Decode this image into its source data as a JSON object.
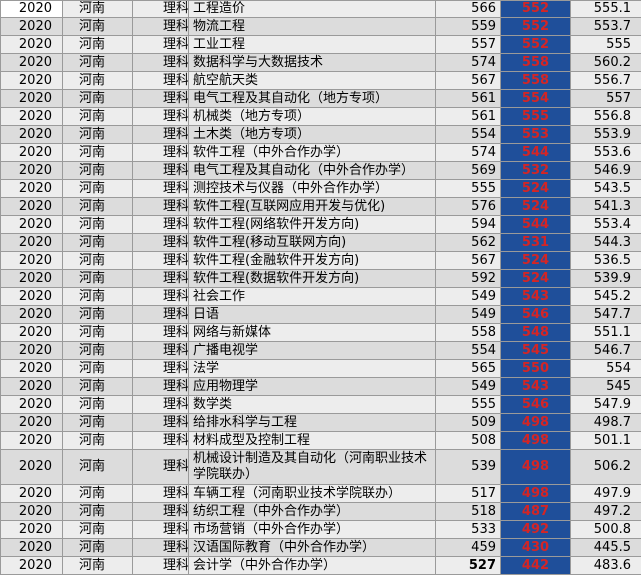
{
  "table": {
    "rows": [
      {
        "year": "2020",
        "province": "河南",
        "category": "理科",
        "major": "工程造价",
        "min": "566",
        "control": "552",
        "avg": "555.1"
      },
      {
        "year": "2020",
        "province": "河南",
        "category": "理科",
        "major": "物流工程",
        "min": "559",
        "control": "552",
        "avg": "553.7"
      },
      {
        "year": "2020",
        "province": "河南",
        "category": "理科",
        "major": "工业工程",
        "min": "557",
        "control": "552",
        "avg": "555"
      },
      {
        "year": "2020",
        "province": "河南",
        "category": "理科",
        "major": "数据科学与大数据技术",
        "min": "574",
        "control": "558",
        "avg": "560.2"
      },
      {
        "year": "2020",
        "province": "河南",
        "category": "理科",
        "major": "航空航天类",
        "min": "567",
        "control": "558",
        "avg": "556.7"
      },
      {
        "year": "2020",
        "province": "河南",
        "category": "理科",
        "major": "电气工程及其自动化（地方专项）",
        "min": "561",
        "control": "554",
        "avg": "557"
      },
      {
        "year": "2020",
        "province": "河南",
        "category": "理科",
        "major": "机械类（地方专项）",
        "min": "561",
        "control": "555",
        "avg": "556.8"
      },
      {
        "year": "2020",
        "province": "河南",
        "category": "理科",
        "major": "土木类（地方专项）",
        "min": "554",
        "control": "553",
        "avg": "553.9"
      },
      {
        "year": "2020",
        "province": "河南",
        "category": "理科",
        "major": "软件工程（中外合作办学）",
        "min": "574",
        "control": "544",
        "avg": "553.6"
      },
      {
        "year": "2020",
        "province": "河南",
        "category": "理科",
        "major": "电气工程及其自动化（中外合作办学）",
        "min": "569",
        "control": "532",
        "avg": "546.9"
      },
      {
        "year": "2020",
        "province": "河南",
        "category": "理科",
        "major": "测控技术与仪器（中外合作办学）",
        "min": "555",
        "control": "524",
        "avg": "543.5"
      },
      {
        "year": "2020",
        "province": "河南",
        "category": "理科",
        "major": "软件工程(互联网应用开发与优化)",
        "min": "576",
        "control": "524",
        "avg": "541.3"
      },
      {
        "year": "2020",
        "province": "河南",
        "category": "理科",
        "major": "软件工程(网络软件开发方向)",
        "min": "594",
        "control": "544",
        "avg": "553.4"
      },
      {
        "year": "2020",
        "province": "河南",
        "category": "理科",
        "major": "软件工程(移动互联网方向)",
        "min": "562",
        "control": "531",
        "avg": "544.3"
      },
      {
        "year": "2020",
        "province": "河南",
        "category": "理科",
        "major": "软件工程(金融软件开发方向)",
        "min": "567",
        "control": "524",
        "avg": "536.5"
      },
      {
        "year": "2020",
        "province": "河南",
        "category": "理科",
        "major": "软件工程(数据软件开发方向)",
        "min": "592",
        "control": "524",
        "avg": "539.9"
      },
      {
        "year": "2020",
        "province": "河南",
        "category": "理科",
        "major": "社会工作",
        "min": "549",
        "control": "543",
        "avg": "545.2"
      },
      {
        "year": "2020",
        "province": "河南",
        "category": "理科",
        "major": "日语",
        "min": "549",
        "control": "546",
        "avg": "547.7"
      },
      {
        "year": "2020",
        "province": "河南",
        "category": "理科",
        "major": "网络与新媒体",
        "min": "558",
        "control": "548",
        "avg": "551.1"
      },
      {
        "year": "2020",
        "province": "河南",
        "category": "理科",
        "major": "广播电视学",
        "min": "554",
        "control": "545",
        "avg": "546.7"
      },
      {
        "year": "2020",
        "province": "河南",
        "category": "理科",
        "major": "法学",
        "min": "565",
        "control": "550",
        "avg": "554"
      },
      {
        "year": "2020",
        "province": "河南",
        "category": "理科",
        "major": "应用物理学",
        "min": "549",
        "control": "543",
        "avg": "545"
      },
      {
        "year": "2020",
        "province": "河南",
        "category": "理科",
        "major": "数学类",
        "min": "555",
        "control": "546",
        "avg": "547.9"
      },
      {
        "year": "2020",
        "province": "河南",
        "category": "理科",
        "major": "给排水科学与工程",
        "min": "509",
        "control": "498",
        "avg": "498.7"
      },
      {
        "year": "2020",
        "province": "河南",
        "category": "理科",
        "major": "材料成型及控制工程",
        "min": "508",
        "control": "498",
        "avg": "501.1"
      },
      {
        "year": "2020",
        "province": "河南",
        "category": "理科",
        "major": "机械设计制造及其自动化（河南职业技术学院联办）",
        "min": "539",
        "control": "498",
        "avg": "506.2",
        "tall": true
      },
      {
        "year": "2020",
        "province": "河南",
        "category": "理科",
        "major": "车辆工程（河南职业技术学院联办）",
        "min": "517",
        "control": "498",
        "avg": "497.9"
      },
      {
        "year": "2020",
        "province": "河南",
        "category": "理科",
        "major": "纺织工程（中外合作办学）",
        "min": "518",
        "control": "487",
        "avg": "497.2"
      },
      {
        "year": "2020",
        "province": "河南",
        "category": "理科",
        "major": "市场营销（中外合作办学）",
        "min": "533",
        "control": "492",
        "avg": "500.8"
      },
      {
        "year": "2020",
        "province": "河南",
        "category": "理科",
        "major": "汉语国际教育（中外合作办学）",
        "min": "459",
        "control": "430",
        "avg": "445.5"
      },
      {
        "year": "2020",
        "province": "河南",
        "category": "理科",
        "major": "会计学（中外合作办学）",
        "min": "527",
        "control": "442",
        "avg": "483.6",
        "bold_min": true
      }
    ]
  }
}
